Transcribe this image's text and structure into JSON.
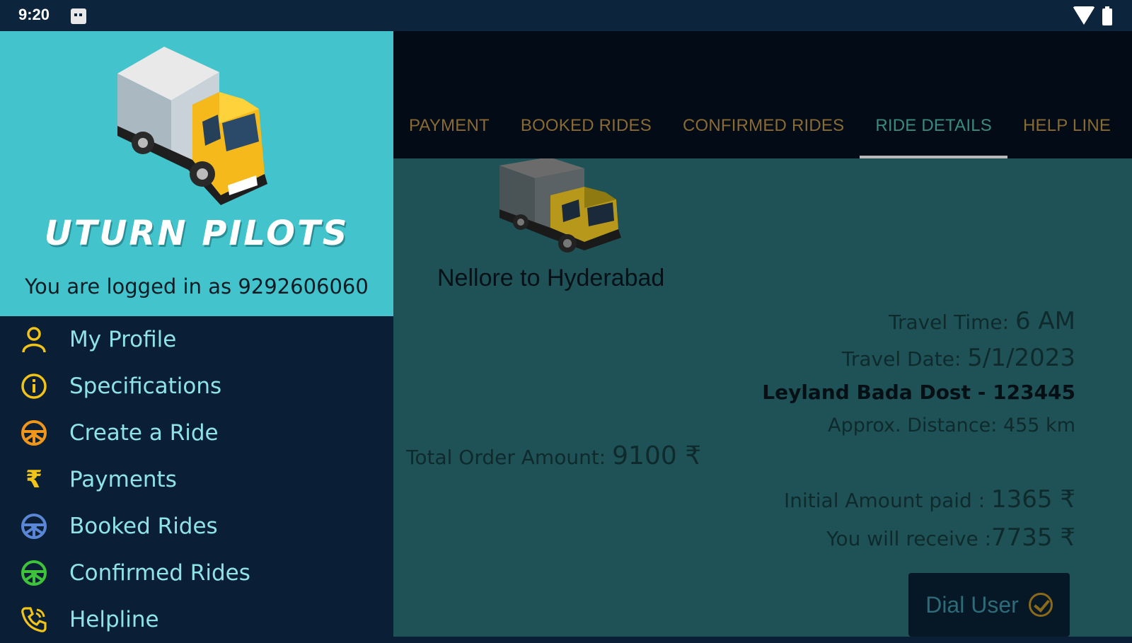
{
  "status_bar": {
    "time": "9:20"
  },
  "tabs": [
    {
      "label": "PAYMENT",
      "active": false
    },
    {
      "label": "BOOKED RIDES",
      "active": false
    },
    {
      "label": "CONFIRMED RIDES",
      "active": false
    },
    {
      "label": "RIDE DETAILS",
      "active": true
    },
    {
      "label": "HELP LINE",
      "active": false
    }
  ],
  "ride": {
    "route": "Nellore to Hyderabad",
    "travel_time_label": "Travel Time: ",
    "travel_time": "6 AM",
    "travel_date_label": "Travel Date: ",
    "travel_date": "5/1/2023",
    "vehicle": "Leyland Bada Dost - 123445",
    "distance": "Approx. Distance: 455 km",
    "total_label": "Total Order Amount: ",
    "total": "9100 ₹",
    "initial_label": "Initial Amount paid : ",
    "initial": "1365 ₹",
    "receive_label": "You will receive :",
    "receive": "7735 ₹",
    "dial_label": "Dial User"
  },
  "drawer": {
    "brand": "UTURN PILOTS",
    "logged_in": "You are logged in as 9292606060",
    "menu": [
      {
        "label": "My Profile",
        "icon": "person-icon",
        "color": "#f2c418"
      },
      {
        "label": "Specifications",
        "icon": "info-icon",
        "color": "#f2c418"
      },
      {
        "label": "Create a Ride",
        "icon": "steering-wheel-icon",
        "color": "#f0961a"
      },
      {
        "label": "Payments",
        "icon": "rupee-icon",
        "color": "#f2c418"
      },
      {
        "label": "Booked Rides",
        "icon": "steering-wheel-icon",
        "color": "#5a86d6"
      },
      {
        "label": "Confirmed Rides",
        "icon": "steering-wheel-icon",
        "color": "#3ec43a"
      },
      {
        "label": "Helpline",
        "icon": "phone-icon",
        "color": "#f2c418"
      }
    ]
  },
  "colors": {
    "drawer_header": "#43c4cc",
    "drawer_bg": "#0a1f35",
    "content_bg": "#1f5256",
    "appbar_bg": "#020b16"
  }
}
